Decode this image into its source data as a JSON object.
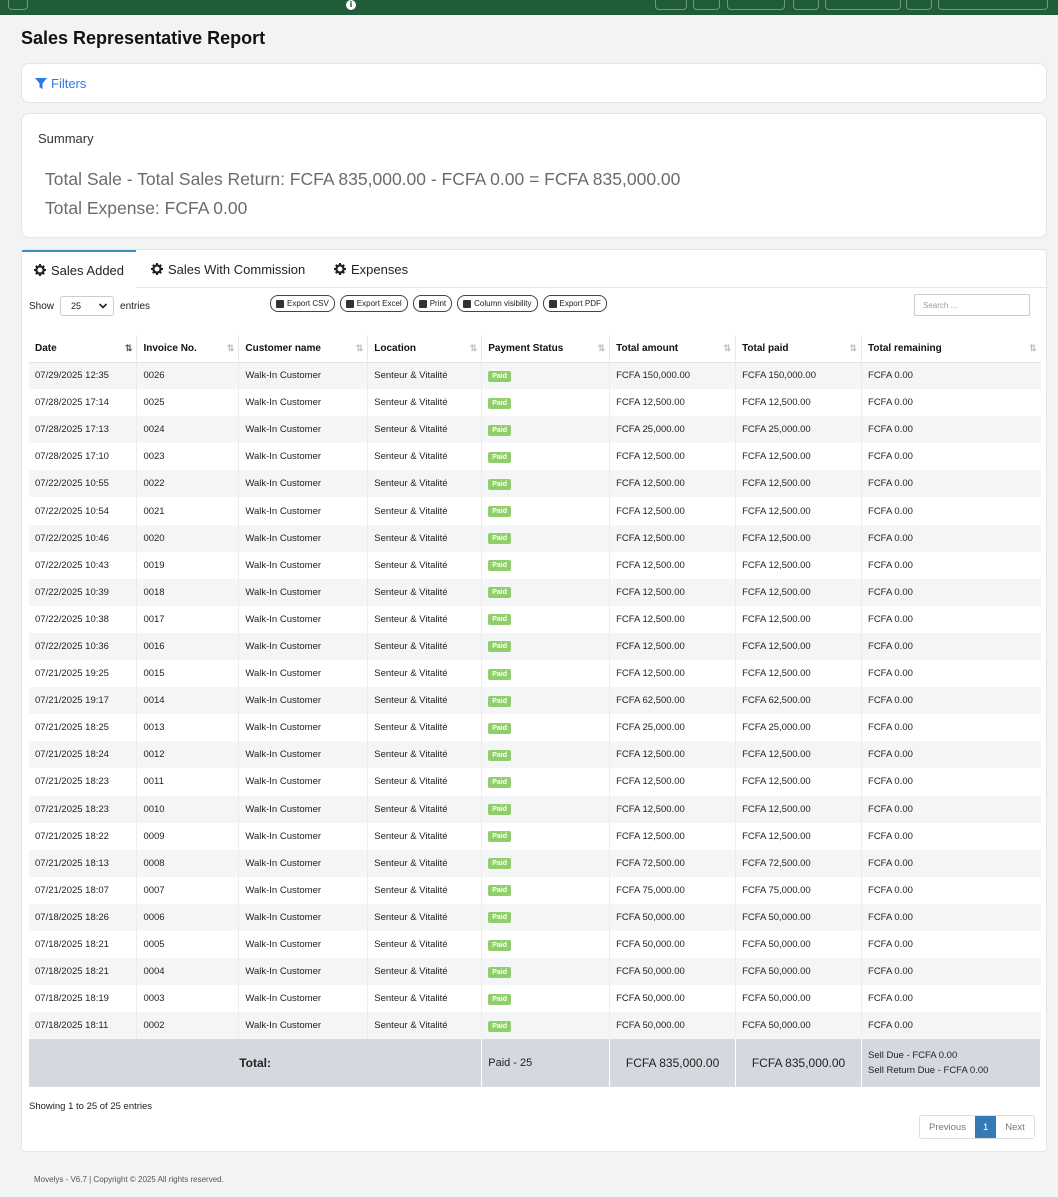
{
  "topbar": {
    "info_glyph": "i"
  },
  "page_title": "Sales Representative Report",
  "filters": {
    "label": "Filters",
    "icon": "filter-icon"
  },
  "summary": {
    "heading": "Summary",
    "line1": "Total Sale - Total Sales Return: FCFA 835,000.00 - FCFA 0.00 = FCFA 835,000.00",
    "line2": "Total Expense: FCFA 0.00"
  },
  "tabs": [
    {
      "label": "Sales Added",
      "icon": "gear-icon",
      "active": true
    },
    {
      "label": "Sales With Commission",
      "icon": "gear-icon",
      "active": false
    },
    {
      "label": "Expenses",
      "icon": "gear-icon",
      "active": false
    }
  ],
  "length_menu": {
    "show": "Show",
    "value": "25",
    "entries": "entries"
  },
  "export_buttons": {
    "csv": "Export CSV",
    "excel": "Export Excel",
    "print": "Print",
    "colvis": "Column visibility",
    "pdf": "Export PDF"
  },
  "search": {
    "placeholder": "Search ..."
  },
  "table": {
    "headers": [
      "Date",
      "Invoice No.",
      "Customer name",
      "Location",
      "Payment Status",
      "Total amount",
      "Total paid",
      "Total remaining"
    ],
    "rows": [
      [
        "07/29/2025 12:35",
        "0026",
        "Walk-In Customer",
        "Senteur & Vitalité",
        "Paid",
        "FCFA 150,000.00",
        "FCFA 150,000.00",
        "FCFA 0.00"
      ],
      [
        "07/28/2025 17:14",
        "0025",
        "Walk-In Customer",
        "Senteur & Vitalité",
        "Paid",
        "FCFA 12,500.00",
        "FCFA 12,500.00",
        "FCFA 0.00"
      ],
      [
        "07/28/2025 17:13",
        "0024",
        "Walk-In Customer",
        "Senteur & Vitalité",
        "Paid",
        "FCFA 25,000.00",
        "FCFA 25,000.00",
        "FCFA 0.00"
      ],
      [
        "07/28/2025 17:10",
        "0023",
        "Walk-In Customer",
        "Senteur & Vitalité",
        "Paid",
        "FCFA 12,500.00",
        "FCFA 12,500.00",
        "FCFA 0.00"
      ],
      [
        "07/22/2025 10:55",
        "0022",
        "Walk-In Customer",
        "Senteur & Vitalité",
        "Paid",
        "FCFA 12,500.00",
        "FCFA 12,500.00",
        "FCFA 0.00"
      ],
      [
        "07/22/2025 10:54",
        "0021",
        "Walk-In Customer",
        "Senteur & Vitalité",
        "Paid",
        "FCFA 12,500.00",
        "FCFA 12,500.00",
        "FCFA 0.00"
      ],
      [
        "07/22/2025 10:46",
        "0020",
        "Walk-In Customer",
        "Senteur & Vitalité",
        "Paid",
        "FCFA 12,500.00",
        "FCFA 12,500.00",
        "FCFA 0.00"
      ],
      [
        "07/22/2025 10:43",
        "0019",
        "Walk-In Customer",
        "Senteur & Vitalité",
        "Paid",
        "FCFA 12,500.00",
        "FCFA 12,500.00",
        "FCFA 0.00"
      ],
      [
        "07/22/2025 10:39",
        "0018",
        "Walk-In Customer",
        "Senteur & Vitalité",
        "Paid",
        "FCFA 12,500.00",
        "FCFA 12,500.00",
        "FCFA 0.00"
      ],
      [
        "07/22/2025 10:38",
        "0017",
        "Walk-In Customer",
        "Senteur & Vitalité",
        "Paid",
        "FCFA 12,500.00",
        "FCFA 12,500.00",
        "FCFA 0.00"
      ],
      [
        "07/22/2025 10:36",
        "0016",
        "Walk-In Customer",
        "Senteur & Vitalité",
        "Paid",
        "FCFA 12,500.00",
        "FCFA 12,500.00",
        "FCFA 0.00"
      ],
      [
        "07/21/2025 19:25",
        "0015",
        "Walk-In Customer",
        "Senteur & Vitalité",
        "Paid",
        "FCFA 12,500.00",
        "FCFA 12,500.00",
        "FCFA 0.00"
      ],
      [
        "07/21/2025 19:17",
        "0014",
        "Walk-In Customer",
        "Senteur & Vitalité",
        "Paid",
        "FCFA 62,500.00",
        "FCFA 62,500.00",
        "FCFA 0.00"
      ],
      [
        "07/21/2025 18:25",
        "0013",
        "Walk-In Customer",
        "Senteur & Vitalité",
        "Paid",
        "FCFA 25,000.00",
        "FCFA 25,000.00",
        "FCFA 0.00"
      ],
      [
        "07/21/2025 18:24",
        "0012",
        "Walk-In Customer",
        "Senteur & Vitalité",
        "Paid",
        "FCFA 12,500.00",
        "FCFA 12,500.00",
        "FCFA 0.00"
      ],
      [
        "07/21/2025 18:23",
        "0011",
        "Walk-In Customer",
        "Senteur & Vitalité",
        "Paid",
        "FCFA 12,500.00",
        "FCFA 12,500.00",
        "FCFA 0.00"
      ],
      [
        "07/21/2025 18:23",
        "0010",
        "Walk-In Customer",
        "Senteur & Vitalité",
        "Paid",
        "FCFA 12,500.00",
        "FCFA 12,500.00",
        "FCFA 0.00"
      ],
      [
        "07/21/2025 18:22",
        "0009",
        "Walk-In Customer",
        "Senteur & Vitalité",
        "Paid",
        "FCFA 12,500.00",
        "FCFA 12,500.00",
        "FCFA 0.00"
      ],
      [
        "07/21/2025 18:13",
        "0008",
        "Walk-In Customer",
        "Senteur & Vitalité",
        "Paid",
        "FCFA 72,500.00",
        "FCFA 72,500.00",
        "FCFA 0.00"
      ],
      [
        "07/21/2025 18:07",
        "0007",
        "Walk-In Customer",
        "Senteur & Vitalité",
        "Paid",
        "FCFA 75,000.00",
        "FCFA 75,000.00",
        "FCFA 0.00"
      ],
      [
        "07/18/2025 18:26",
        "0006",
        "Walk-In Customer",
        "Senteur & Vitalité",
        "Paid",
        "FCFA 50,000.00",
        "FCFA 50,000.00",
        "FCFA 0.00"
      ],
      [
        "07/18/2025 18:21",
        "0005",
        "Walk-In Customer",
        "Senteur & Vitalité",
        "Paid",
        "FCFA 50,000.00",
        "FCFA 50,000.00",
        "FCFA 0.00"
      ],
      [
        "07/18/2025 18:21",
        "0004",
        "Walk-In Customer",
        "Senteur & Vitalité",
        "Paid",
        "FCFA 50,000.00",
        "FCFA 50,000.00",
        "FCFA 0.00"
      ],
      [
        "07/18/2025 18:19",
        "0003",
        "Walk-In Customer",
        "Senteur & Vitalité",
        "Paid",
        "FCFA 50,000.00",
        "FCFA 50,000.00",
        "FCFA 0.00"
      ],
      [
        "07/18/2025 18:11",
        "0002",
        "Walk-In Customer",
        "Senteur & Vitalité",
        "Paid",
        "FCFA 50,000.00",
        "FCFA 50,000.00",
        "FCFA 0.00"
      ]
    ],
    "footer": {
      "label": "Total:",
      "payment_status": "Paid - 25",
      "total_amount": "FCFA 835,000.00",
      "total_paid": "FCFA 835,000.00",
      "sell_due": "Sell Due - FCFA 0.00",
      "sell_return_due": "Sell Return Due - FCFA 0.00"
    }
  },
  "info": "Showing 1 to 25 of 25 entries",
  "pagination": {
    "previous": "Previous",
    "current": "1",
    "next": "Next"
  },
  "footer_text": "Movelys - V6.7 | Copyright © 2025 All rights reserved.",
  "colors": {
    "topbar": "#1f5c37",
    "accent": "#2c7be5",
    "paid_badge": "#8fce6a",
    "pager_active": "#337ab7"
  }
}
